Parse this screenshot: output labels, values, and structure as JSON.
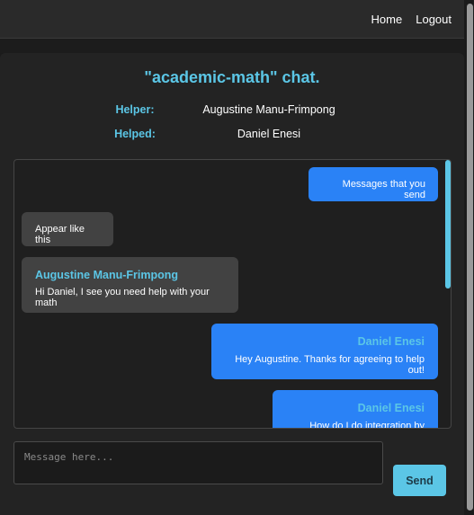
{
  "nav": {
    "home_label": "Home",
    "logout_label": "Logout"
  },
  "chat": {
    "title": "\"academic-math\" chat.",
    "helper_label": "Helper:",
    "helper_name": "Augustine Manu-Frimpong",
    "helped_label": "Helped:",
    "helped_name": "Daniel Enesi",
    "messages": [
      {
        "side": "sent",
        "sender": "",
        "text": "Messages that you send"
      },
      {
        "side": "received",
        "sender": "",
        "text": "Appear like this"
      },
      {
        "side": "received",
        "sender": "Augustine Manu-Frimpong",
        "text": "Hi Daniel, I see you need help with your math"
      },
      {
        "side": "sent",
        "sender": "Daniel Enesi",
        "text": "Hey Augustine. Thanks for agreeing to help out!"
      },
      {
        "side": "sent",
        "sender": "Daniel Enesi",
        "text": "How do I do integration by parts?"
      }
    ]
  },
  "composer": {
    "placeholder": "Message here...",
    "send_label": "Send"
  },
  "colors": {
    "accent": "#5bc6e6",
    "sent_bubble": "#2a82f6",
    "received_bubble": "#424242",
    "background": "#232323"
  }
}
